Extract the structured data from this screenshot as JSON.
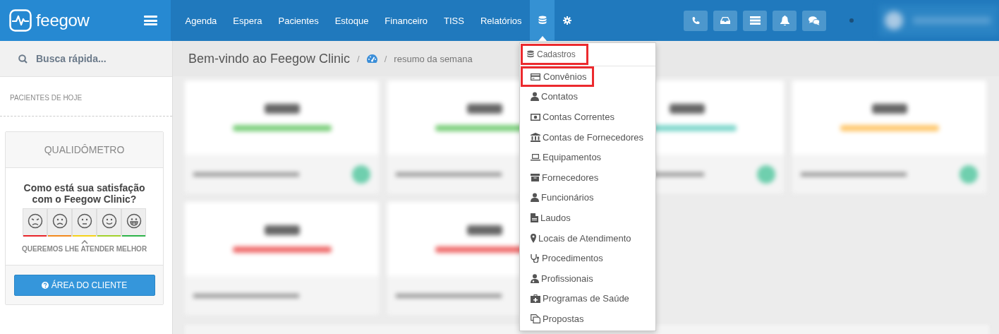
{
  "header": {
    "logo": "feegow",
    "nav_links": [
      "Agenda",
      "Espera",
      "Pacientes",
      "Estoque",
      "Financeiro",
      "TISS",
      "Relatórios"
    ],
    "nav_icons": [
      {
        "kind": "database",
        "selected": true
      },
      {
        "kind": "gear",
        "selected": false
      }
    ],
    "toolbar": [
      {
        "kind": "phone"
      },
      {
        "kind": "inbox"
      },
      {
        "kind": "server"
      },
      {
        "kind": "bell"
      },
      {
        "kind": "chat"
      }
    ]
  },
  "sidebar": {
    "search": {
      "placeholder": "Busca rápida..."
    },
    "section_title": "PACIENTES DE HOJE",
    "widget": {
      "title": "QUALIDÔMETRO",
      "question": "Como está sua satisfação com o Feegow Clinic?",
      "faces": [
        {
          "kind": "angry",
          "color": "#e8262b",
          "selected": false
        },
        {
          "kind": "sad",
          "color": "#f28a1e",
          "selected": false
        },
        {
          "kind": "neutral",
          "color": "#f5d21a",
          "selected": true
        },
        {
          "kind": "smile",
          "color": "#a3d12d",
          "selected": false
        },
        {
          "kind": "grin",
          "color": "#2eb34a",
          "selected": false
        }
      ],
      "caption": "QUEREMOS LHE ATENDER MELHOR",
      "button": "ÁREA DO CLIENTE"
    }
  },
  "main": {
    "title": "Bem-vindo ao Feegow Clinic",
    "separators": [
      "/",
      "/"
    ],
    "breadcrumb": "resumo da semana"
  },
  "menu": {
    "header": {
      "label": "Cadastros",
      "annotated": true
    },
    "items": [
      {
        "label": "Convênios",
        "annotated": true
      },
      {
        "label": "Contatos",
        "annotated": false
      },
      {
        "label": "Contas Correntes",
        "annotated": false
      },
      {
        "label": "Contas de Fornecedores",
        "annotated": false
      },
      {
        "label": "Equipamentos",
        "annotated": false
      },
      {
        "label": "Fornecedores",
        "annotated": false
      },
      {
        "label": "Funcionários",
        "annotated": false
      },
      {
        "label": "Laudos",
        "annotated": false
      },
      {
        "label": "Locais de Atendimento",
        "annotated": false
      },
      {
        "label": "Procedimentos",
        "annotated": false
      },
      {
        "label": "Profissionais",
        "annotated": false
      },
      {
        "label": "Programas de Saúde",
        "annotated": false
      },
      {
        "label": "Propostas",
        "annotated": false
      }
    ]
  }
}
